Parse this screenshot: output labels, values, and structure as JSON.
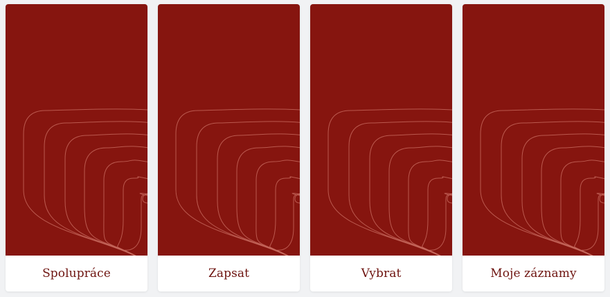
{
  "colors": {
    "card_background": "#86150f",
    "contour_lines": "#c86a5f",
    "label_text": "#6e1410",
    "page_background": "#f1f2f4"
  },
  "cards": [
    {
      "label": "Spolupráce",
      "art": "contour-pattern"
    },
    {
      "label": "Zapsat",
      "art": "contour-pattern"
    },
    {
      "label": "Vybrat",
      "art": "contour-pattern"
    },
    {
      "label": "Moje záznamy",
      "art": "contour-pattern"
    }
  ]
}
